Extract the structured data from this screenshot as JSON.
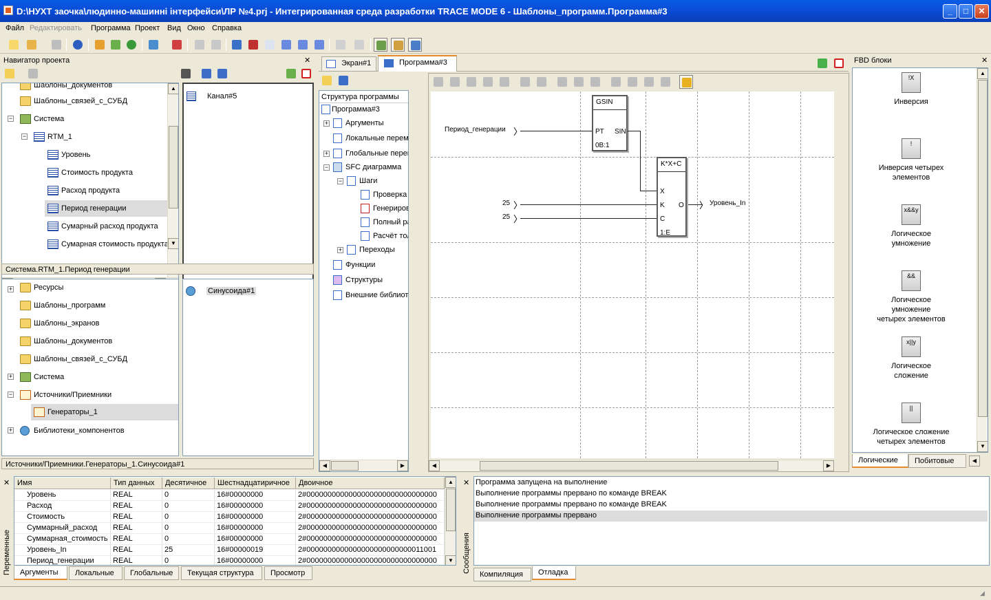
{
  "window": {
    "title": "D:\\НУХТ заочка\\людинно-машинні інтерфейси\\ЛР №4.prj - Интегрированная среда разработки TRACE MODE 6 - Шаблоны_программ.Программа#3"
  },
  "menu": [
    "Файл",
    "Редактировать",
    "Программа",
    "Проект",
    "Вид",
    "Окно",
    "Справка"
  ],
  "navigator": {
    "title": "Навигатор проекта",
    "top_tree": [
      {
        "label": "Шаблоны_документов",
        "icon": "folder-icon"
      },
      {
        "label": "Шаблоны_связей_с_СУБД",
        "icon": "folder-icon"
      },
      {
        "label": "Система",
        "icon": "system-icon"
      },
      {
        "label": "RTM_1",
        "icon": "rtm-icon"
      },
      {
        "label": "Уровень",
        "icon": "channel-icon"
      },
      {
        "label": "Стоимость продукта",
        "icon": "channel-icon"
      },
      {
        "label": "Расход продукта",
        "icon": "channel-icon"
      },
      {
        "label": "Период генерации",
        "icon": "channel-icon"
      },
      {
        "label": "Сумарный расход продукта",
        "icon": "channel-icon"
      },
      {
        "label": "Сумарная стоимость продукта",
        "icon": "channel-icon"
      }
    ],
    "top_right_item": "Канал#5",
    "top_path": "Система.RTM_1.Период генерации",
    "bottom_tree": [
      {
        "label": "Ресурсы",
        "icon": "folder-icon"
      },
      {
        "label": "Шаблоны_программ",
        "icon": "folder-icon"
      },
      {
        "label": "Шаблоны_экранов",
        "icon": "folder-icon"
      },
      {
        "label": "Шаблоны_документов",
        "icon": "folder-icon"
      },
      {
        "label": "Шаблоны_связей_с_СУБД",
        "icon": "folder-icon"
      },
      {
        "label": "Система",
        "icon": "system-icon"
      },
      {
        "label": "Источники/Приемники",
        "icon": "source-icon"
      },
      {
        "label": "Генераторы_1",
        "icon": "generator-icon"
      },
      {
        "label": "Библиотеки_компонентов",
        "icon": "library-icon"
      }
    ],
    "bottom_right_item": "Синусоида#1",
    "bottom_path": "Источники/Приемники.Генераторы_1.Синусоида#1"
  },
  "editor_tabs": [
    "Экран#1",
    "Программа#3"
  ],
  "program_tree": {
    "title": "Структура программы",
    "items": [
      "Программа#3",
      "Аргументы",
      "Локальные переменные",
      "Глобальные переменные",
      "SFC диаграмма",
      "Шаги",
      "Проверка",
      "Генерирование",
      "Полный расчёт",
      "Расчёт тол",
      "Переходы",
      "Функции",
      "Структуры",
      "Внешние библиотеки"
    ]
  },
  "diagram": {
    "gsin": {
      "name": "GSIN",
      "in": "PT",
      "out": "SIN",
      "id": "0B:1"
    },
    "kxc": {
      "name": "K*X+C",
      "in_x": "X",
      "in_k": "K",
      "in_c": "C",
      "out": "O",
      "id": "1:E"
    },
    "input_label": "Период_генерации",
    "const_k": "25",
    "const_c": "25",
    "output_label": "Уровень_In"
  },
  "fbd": {
    "title": "FBD блоки",
    "items": [
      {
        "icon_text": "!X",
        "label": "Инверсия"
      },
      {
        "icon_text": "!",
        "label": "Инверсия четырех элементов"
      },
      {
        "icon_text": "x&&y",
        "label": "Логическое умножение"
      },
      {
        "icon_text": "&&",
        "label": "Логическое умножение четырех элементов"
      },
      {
        "icon_text": "x||y",
        "label": "Логическое сложение"
      },
      {
        "icon_text": "||",
        "label": "Логическое сложение четырех элементов"
      }
    ],
    "tabs": [
      "Логические",
      "Побитовые"
    ]
  },
  "variables": {
    "side_label": "Переменные",
    "columns": [
      "Имя",
      "Тип данных",
      "Десятичное",
      "Шестнадцатиричное",
      "Двоичное"
    ],
    "rows": [
      [
        "Уровень",
        "REAL",
        "0",
        "16#00000000",
        "2#0000000000000000000000000000000"
      ],
      [
        "Расход",
        "REAL",
        "0",
        "16#00000000",
        "2#0000000000000000000000000000000"
      ],
      [
        "Стоимость",
        "REAL",
        "0",
        "16#00000000",
        "2#0000000000000000000000000000000"
      ],
      [
        "Суммарный_расход",
        "REAL",
        "0",
        "16#00000000",
        "2#0000000000000000000000000000000"
      ],
      [
        "Суммарная_стоимость",
        "REAL",
        "0",
        "16#00000000",
        "2#0000000000000000000000000000000"
      ],
      [
        "Уровень_In",
        "REAL",
        "25",
        "16#00000019",
        "2#0000000000000000000000000011001"
      ],
      [
        "Период_генерации",
        "REAL",
        "0",
        "16#00000000",
        "2#0000000000000000000000000000000"
      ]
    ],
    "tabs": [
      "Аргументы",
      "Локальные",
      "Глобальные",
      "Текущая структура",
      "Просмотр"
    ]
  },
  "messages": {
    "side_label": "Сообщения",
    "lines": [
      "Программа запущена на выполнение",
      "Выполнение программы прервано по команде BREAK",
      "Выполнение программы прервано по команде BREAK",
      "Выполнение программы прервано"
    ],
    "tabs": [
      "Компиляция",
      "Отладка"
    ]
  }
}
